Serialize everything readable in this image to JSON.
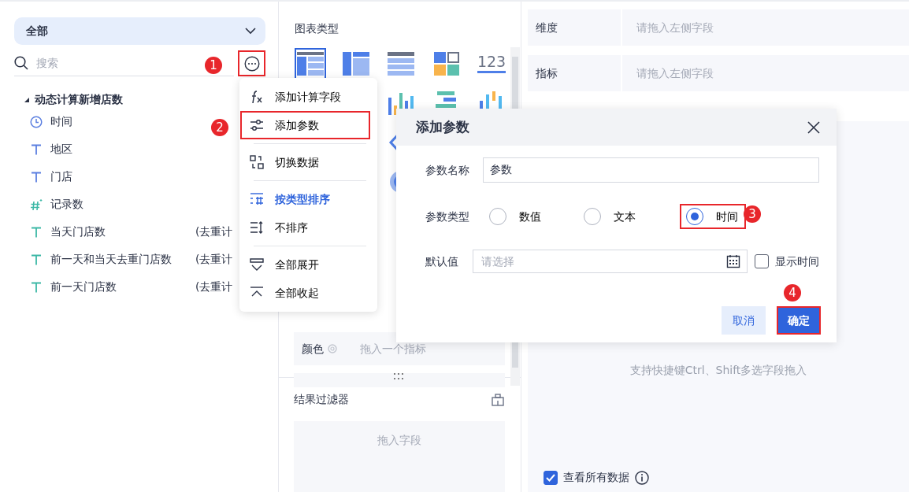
{
  "field_panel": {
    "scope": "全部",
    "search": {
      "placeholder": "搜索",
      "highlighted": true
    },
    "tree": {
      "label": "动态计算新增店数",
      "expanded": true,
      "children": [
        {
          "name": "时间",
          "kind": "date"
        },
        {
          "name": "地区",
          "kind": "dimension"
        },
        {
          "name": "门店",
          "kind": "dimension"
        },
        {
          "name": "记录数",
          "kind": "count"
        },
        {
          "name": "当天门店数",
          "kind": "measure",
          "aggregation": "(去重计"
        },
        {
          "name": "前一天和当天去重门店数",
          "kind": "measure",
          "aggregation": "(去重计"
        },
        {
          "name": "前一天门店数",
          "kind": "measure",
          "aggregation": "(去重计"
        }
      ]
    }
  },
  "more_menu": {
    "groups": [
      [
        {
          "label": "添加计算字段",
          "selected": false,
          "highlighted": false
        },
        {
          "label": "添加参数",
          "selected": false,
          "highlighted": true
        }
      ],
      [
        {
          "label": "切换数据",
          "selected": false,
          "highlighted": false
        }
      ],
      [
        {
          "label": "按类型排序",
          "selected": true,
          "highlighted": false
        },
        {
          "label": "不排序",
          "selected": false,
          "highlighted": false
        }
      ],
      [
        {
          "label": "全部展开",
          "selected": false,
          "highlighted": false
        },
        {
          "label": "全部收起",
          "selected": false,
          "highlighted": false
        }
      ]
    ]
  },
  "chart_panel": {
    "title": "图表类型",
    "chart_types": [
      {
        "selected": true
      },
      {
        "selected": false
      },
      {
        "selected": false
      },
      {
        "selected": false
      },
      {
        "selected": false,
        "label": "123"
      }
    ],
    "color_zone": {
      "label": "颜色",
      "placeholder": "拖入一个指标"
    },
    "filter": {
      "title": "结果过滤器",
      "placeholder": "拖入字段"
    }
  },
  "shelf": {
    "rows": [
      {
        "label": "维度",
        "placeholder": "请拖入左侧字段"
      },
      {
        "label": "指标",
        "placeholder": "请拖入左侧字段"
      }
    ],
    "empty_hint": "支持快捷键Ctrl、Shift多选字段拖入",
    "view_all": {
      "label": "查看所有数据",
      "checked": true
    }
  },
  "dialog": {
    "title": "添加参数",
    "name": {
      "label": "参数名称",
      "value": "参数"
    },
    "type": {
      "label": "参数类型",
      "options": [
        {
          "label": "数值",
          "selected": false,
          "highlighted": false
        },
        {
          "label": "文本",
          "selected": false,
          "highlighted": false
        },
        {
          "label": "时间",
          "selected": true,
          "highlighted": true
        }
      ]
    },
    "default": {
      "label": "默认值",
      "placeholder": "请选择",
      "show_time": {
        "label": "显示时间",
        "checked": false
      }
    },
    "buttons": [
      {
        "label": "取消",
        "kind": "secondary",
        "highlighted": false
      },
      {
        "label": "确定",
        "kind": "primary",
        "highlighted": true
      }
    ]
  },
  "annotations": [
    {
      "number": "1"
    },
    {
      "number": "2"
    },
    {
      "number": "3"
    },
    {
      "number": "4"
    }
  ]
}
